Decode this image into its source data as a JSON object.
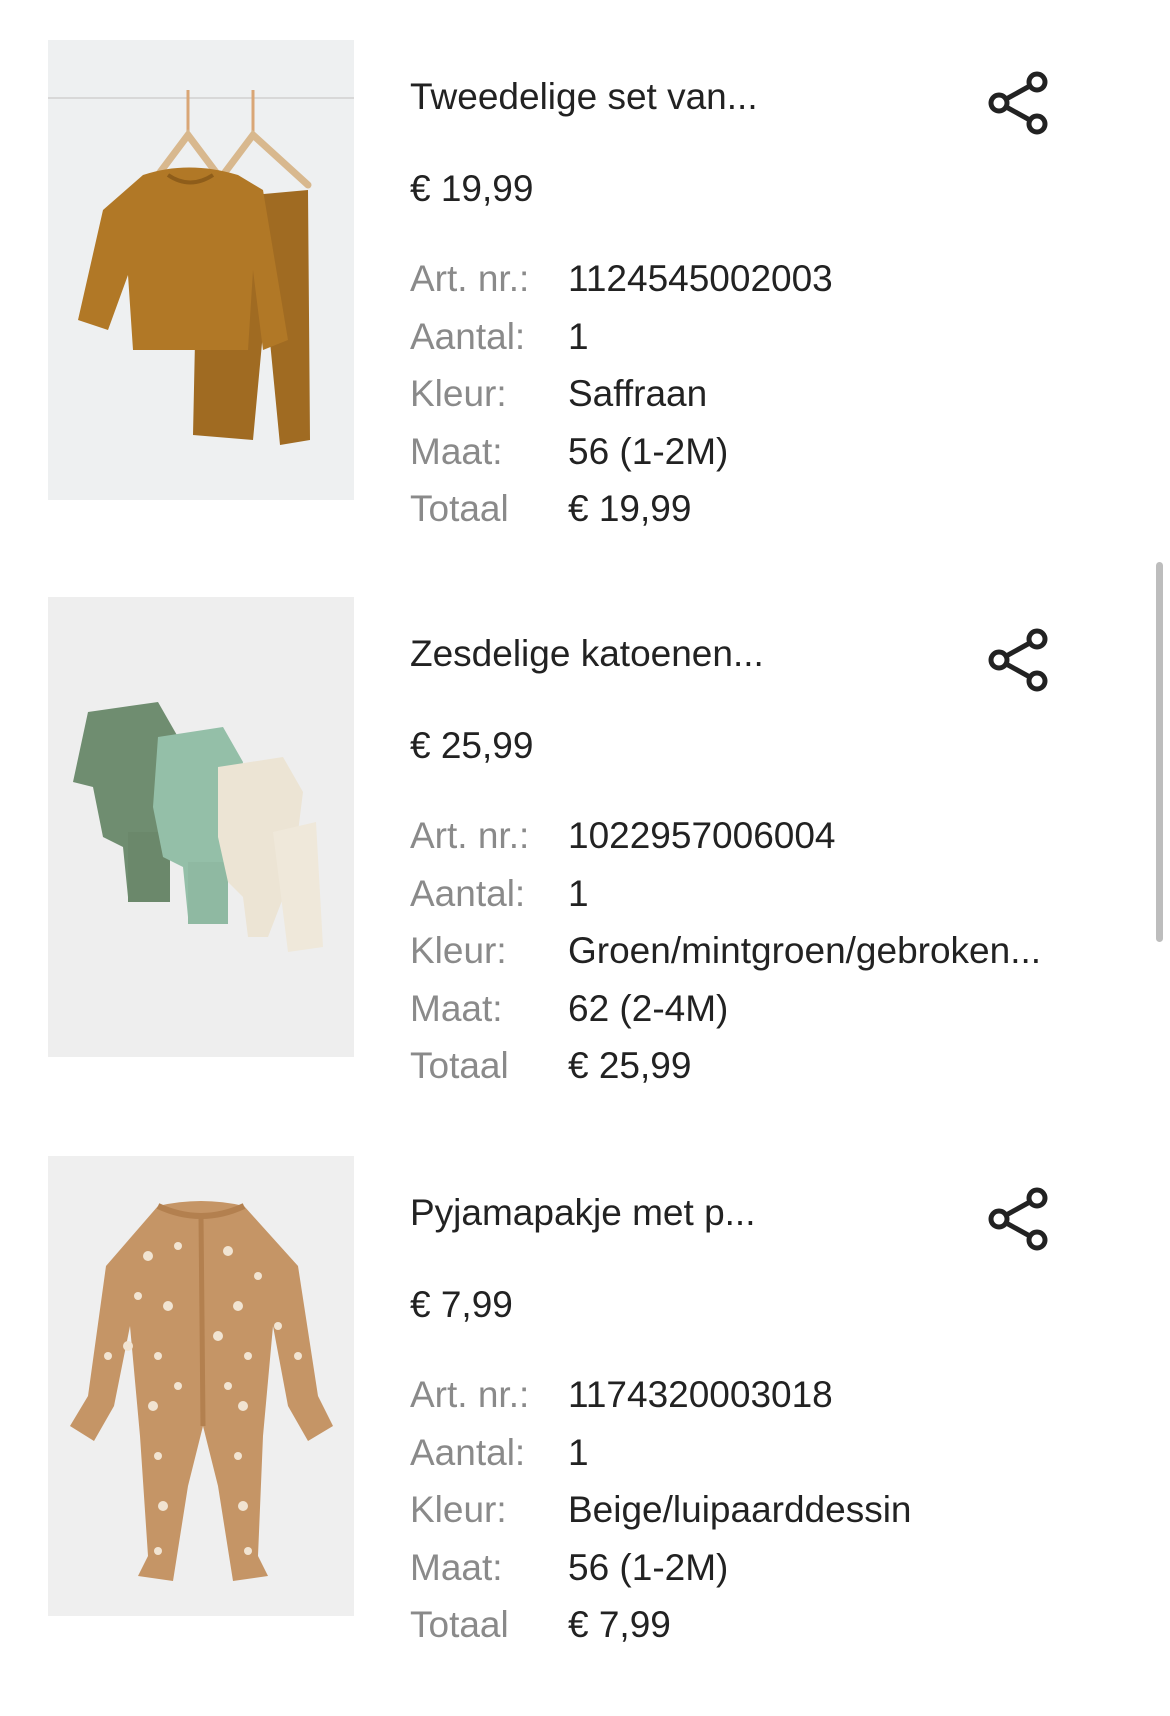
{
  "labels": {
    "art": "Art. nr.:",
    "qty": "Aantal:",
    "color": "Kleur:",
    "size": "Maat:",
    "total": "Totaal"
  },
  "items": [
    {
      "title": "Tweedelige set van...",
      "price": "€ 19,99",
      "art": "1124545002003",
      "qty": "1",
      "color": "Saffraan",
      "size": "56 (1-2M)",
      "total": "€ 19,99"
    },
    {
      "title": "Zesdelige katoenen...",
      "price": "€ 25,99",
      "art": "1022957006004",
      "qty": "1",
      "color": "Groen/mintgroen/gebroken...",
      "size": "62 (2-4M)",
      "total": "€ 25,99"
    },
    {
      "title": "Pyjamapakje met p...",
      "price": "€ 7,99",
      "art": "1174320003018",
      "qty": "1",
      "color": "Beige/luipaarddessin",
      "size": "56 (1-2M)",
      "total": "€ 7,99"
    }
  ],
  "icons": {
    "share": "share-icon"
  },
  "colors": {
    "text": "#222222",
    "label": "#8a8a8a",
    "thumb_bg": "#eef0f0"
  }
}
